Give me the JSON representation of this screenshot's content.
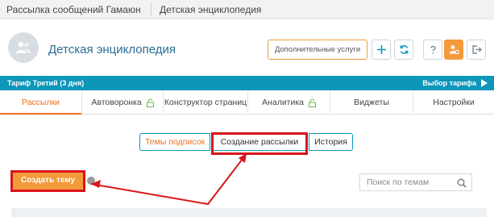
{
  "breadcrumb": {
    "app": "Рассылка сообщений Гамаюн",
    "current": "Детская энциклопедия"
  },
  "header": {
    "project_title": "Детская энциклопедия",
    "extra_services_label": "Дополнительные услуги",
    "icons": [
      "plus-icon",
      "sync-icon",
      "help-icon",
      "settings-icon",
      "logout-icon"
    ]
  },
  "tariff": {
    "label": "Тариф Третий (3 дня)",
    "choose_label": "Выбор тарифа"
  },
  "tabs": [
    {
      "label": "Рассылки",
      "active": true,
      "locked": false
    },
    {
      "label": "Автоворонка",
      "active": false,
      "locked": true
    },
    {
      "label": "Конструктор страниц",
      "active": false,
      "locked": false
    },
    {
      "label": "Аналитика",
      "active": false,
      "locked": true
    },
    {
      "label": "Виджеты",
      "active": false,
      "locked": false
    },
    {
      "label": "Настройки",
      "active": false,
      "locked": false
    }
  ],
  "subtabs": [
    {
      "label": "Темы подписок",
      "active": true
    },
    {
      "label": "Создание рассылки",
      "active": false
    },
    {
      "label": "История",
      "active": false
    }
  ],
  "actions": {
    "create_theme_label": "Создать тему"
  },
  "search": {
    "placeholder": "Поиск по темам",
    "value": ""
  },
  "colors": {
    "accent_orange": "#f39a3a",
    "active_tab_orange": "#e9711e",
    "brand_teal": "#0c96b9",
    "title_blue": "#2a6c96",
    "annotation_red": "#d9151b"
  }
}
